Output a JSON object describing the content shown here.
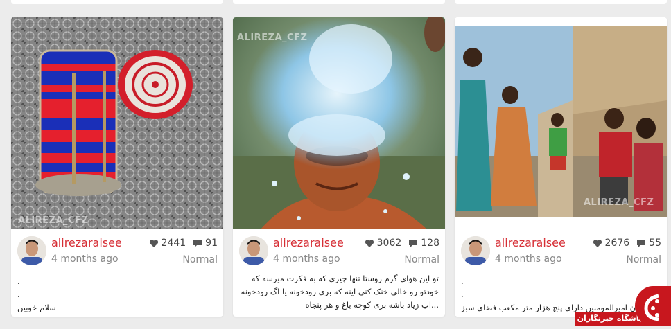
{
  "posts": [
    {
      "watermark": "ALIREZA_CFZ",
      "username": "alirezaraisee",
      "time": "4 months ago",
      "likes": "2441",
      "comments": "91",
      "tier": "Normal",
      "desc": [
        ".",
        ".",
        "سلام خوبین"
      ]
    },
    {
      "watermark": "ALIREZA_CFZ",
      "username": "alirezaraisee",
      "time": "4 months ago",
      "likes": "3062",
      "comments": "128",
      "tier": "Normal",
      "desc": [
        "تو این هوای گرم روستا تنها چیزی که به فکرت میرسه که",
        "خودتو رو خالی خنک کنی اینه که بری رودخونه یا اگ رودخونه",
        "...اب زیاد باشه بری کوچه باغ و هر پنجاه"
      ]
    },
    {
      "watermark": "ALIREZA_CFZ",
      "username": "alirezaraisee",
      "time": "4 months ago",
      "likes": "2676",
      "comments": "55",
      "tier": "Normal",
      "desc": [
        ".",
        ".",
        "ن امیرالمومنین دارای پنج هزار متر مکعب فضای سبز"
      ]
    }
  ],
  "badge": {
    "label": "باشگاه خبرنگاران"
  },
  "icons": {
    "like": "heart-icon",
    "comment": "speech-bubble-icon"
  },
  "colors": {
    "username": "#d62e35",
    "badge": "#c8171e"
  }
}
